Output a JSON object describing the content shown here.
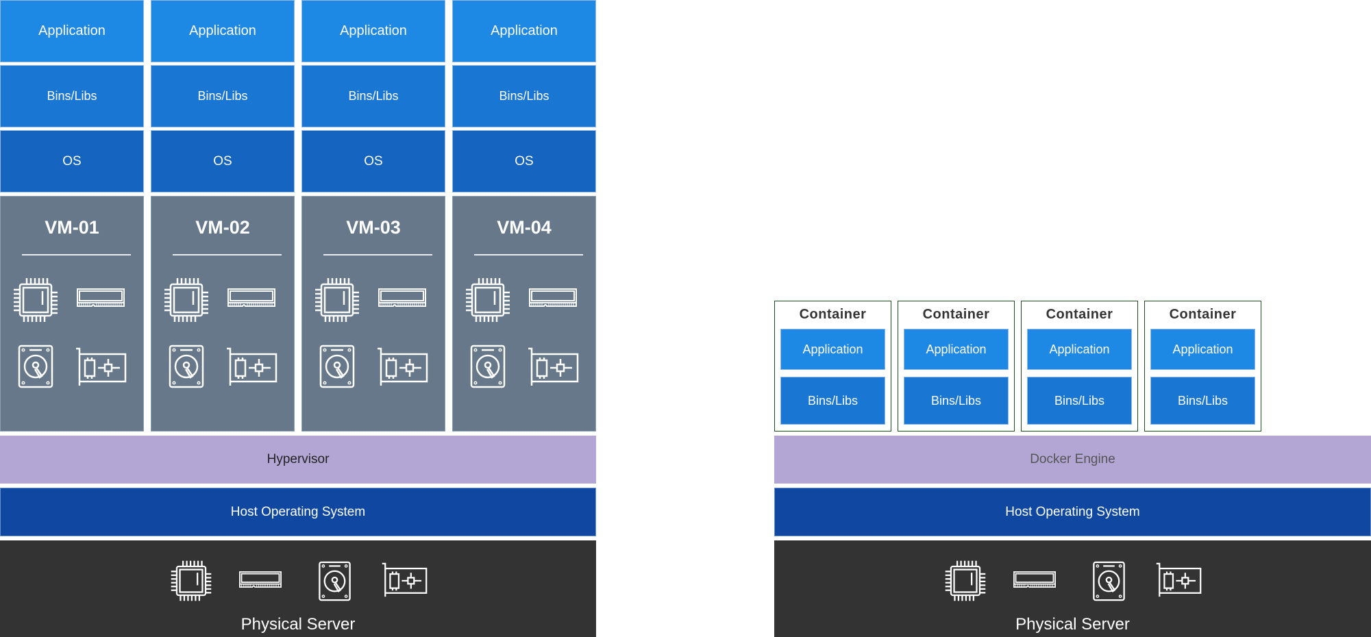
{
  "vm_side": {
    "vms": [
      {
        "app": "Application",
        "bins": "Bins/Libs",
        "os": "OS",
        "name": "VM-01"
      },
      {
        "app": "Application",
        "bins": "Bins/Libs",
        "os": "OS",
        "name": "VM-02"
      },
      {
        "app": "Application",
        "bins": "Bins/Libs",
        "os": "OS",
        "name": "VM-03"
      },
      {
        "app": "Application",
        "bins": "Bins/Libs",
        "os": "OS",
        "name": "VM-04"
      }
    ],
    "vm_icons": [
      "cpu-icon",
      "ram-icon",
      "hard-disk-icon",
      "network-card-icon"
    ],
    "hypervisor": "Hypervisor",
    "host_os": "Host Operating System",
    "physical_server": "Physical Server",
    "physical_icons": [
      "cpu-icon",
      "ram-icon",
      "hard-disk-icon",
      "network-card-icon"
    ]
  },
  "container_side": {
    "containers": [
      {
        "title": "Container",
        "app": "Application",
        "bins": "Bins/Libs"
      },
      {
        "title": "Container",
        "app": "Application",
        "bins": "Bins/Libs"
      },
      {
        "title": "Container",
        "app": "Application",
        "bins": "Bins/Libs"
      },
      {
        "title": "Container",
        "app": "Application",
        "bins": "Bins/Libs"
      }
    ],
    "docker_engine": "Docker Engine",
    "host_os": "Host Operating System",
    "physical_server": "Physical Server",
    "physical_icons": [
      "cpu-icon",
      "ram-icon",
      "hard-disk-icon",
      "network-card-icon"
    ]
  },
  "colors": {
    "application": "#1e88e5",
    "bins_libs": "#1976d2",
    "os": "#1565c0",
    "vm": "#66788a",
    "hypervisor": "#b3a6d4",
    "host_os": "#0f47a1",
    "physical_server": "#333333",
    "container_border": "#1b4d1b"
  }
}
